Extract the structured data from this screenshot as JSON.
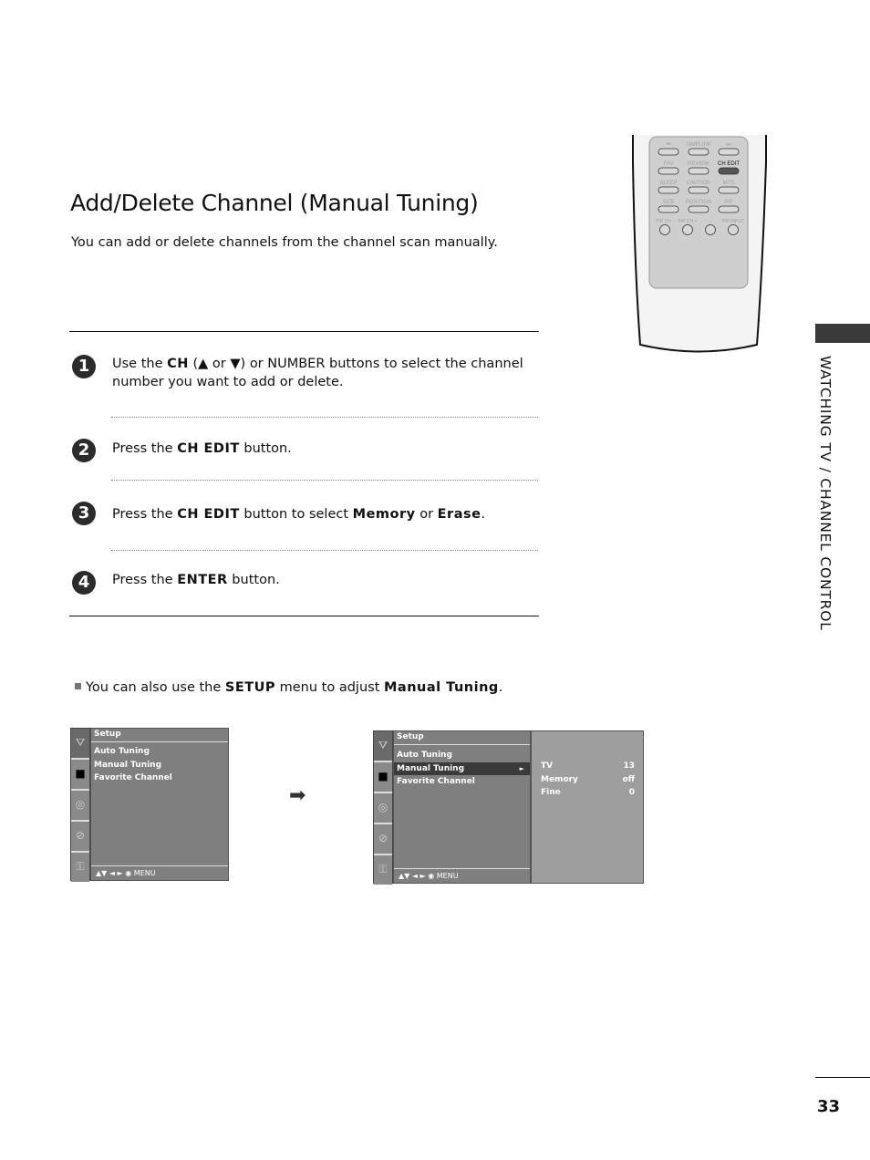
{
  "title": "Add/Delete Channel (Manual Tuning)",
  "subtitle": "You can add or delete channels from the channel scan manually.",
  "steps": [
    {
      "number": "1",
      "parts": {
        "a": "Use the ",
        "b": "CH",
        "c": " (",
        "d": "▲",
        "e": " or ",
        "f": "▼",
        "g": ")  or NUMBER buttons to select the channel number you want to add or delete."
      }
    },
    {
      "number": "2",
      "parts": {
        "a": "Press the ",
        "b": "CH EDIT",
        "c": " button."
      }
    },
    {
      "number": "3",
      "parts": {
        "a": "Press the ",
        "b": "CH EDIT",
        "c": " button to select ",
        "d": "Memory",
        "e": " or ",
        "f": "Erase",
        "g": "."
      }
    },
    {
      "number": "4",
      "parts": {
        "a": "Press the ",
        "b": "ENTER",
        "c": " button."
      }
    }
  ],
  "note": {
    "a": "You can also use the ",
    "b": "SETUP",
    "c": " menu to adjust ",
    "d": "Manual Tuning",
    "e": "."
  },
  "osd_before": {
    "header": "Setup",
    "items": [
      "Auto Tuning",
      "Manual Tuning",
      "Favorite Channel"
    ],
    "footer": "▲▼  ◄ ►   ◉   MENU"
  },
  "osd_after": {
    "header": "Setup",
    "items": [
      "Auto Tuning",
      "Manual Tuning",
      "Favorite Channel"
    ],
    "selected_index": 1,
    "selected_arrow": "►",
    "footer": "▲▼  ◄ ►   ◉   MENU",
    "submenu": [
      {
        "label": "TV",
        "value": "13"
      },
      {
        "label": "Memory",
        "value": "off"
      },
      {
        "label": "Fine",
        "value": "0"
      }
    ]
  },
  "osd_icons": [
    "antenna-icon",
    "picture-icon",
    "speaker-icon",
    "clock-icon",
    "lock-icon"
  ],
  "transition_arrow": "➡",
  "remote": {
    "rows": [
      [
        "⏮",
        "SIMPLINK",
        "⏭"
      ],
      [
        "FAV",
        "REVIEW",
        "CH EDIT"
      ],
      [
        "SLEEP",
        "CAPTION",
        "MTS"
      ],
      [
        "SIZE",
        "POSITION",
        "PIP"
      ]
    ],
    "round_buttons": [
      "PIP CH -",
      "PIP CH +",
      "-",
      "PIP INPUT"
    ],
    "highlighted": "CH EDIT"
  },
  "sidebar": {
    "section": "WATCHING TV / CHANNEL CONTROL"
  },
  "page_number": "33"
}
